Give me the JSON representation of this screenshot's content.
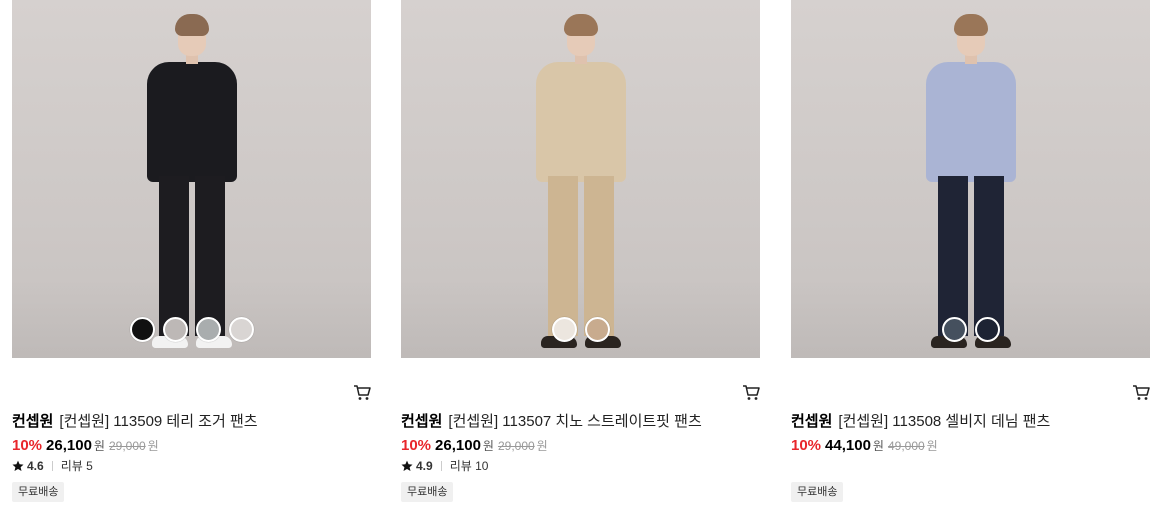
{
  "products": [
    {
      "brand": "컨셉원",
      "name": "[컨셉원] 113509 테리 조거 팬츠",
      "discount": "10%",
      "sale_price": "26,100",
      "currency": "원",
      "original_price": "29,000",
      "rating": "4.6",
      "reviews": "리뷰 5",
      "badge": "무료배송",
      "swatches": [
        "#111111",
        "#bdb8b6",
        "#a9adae",
        "#d9d5d3"
      ],
      "outfit": {
        "top": "#1b1b1f",
        "bottom": "#1d1c20",
        "shoes": "#f2f2f2",
        "hair": "#8a6a52"
      }
    },
    {
      "brand": "컨셉원",
      "name": "[컨셉원] 113507 치노 스트레이트핏 팬츠",
      "discount": "10%",
      "sale_price": "26,100",
      "currency": "원",
      "original_price": "29,000",
      "rating": "4.9",
      "reviews": "리뷰 10",
      "badge": "무료배송",
      "swatches": [
        "#ece6df",
        "#c8ab8e"
      ],
      "outfit": {
        "top": "#d9c6a8",
        "bottom": "#cdb592",
        "shoes": "#2a2420",
        "hair": "#9a7658"
      }
    },
    {
      "brand": "컨셉원",
      "name": "[컨셉원] 113508 셀비지 데님 팬츠",
      "discount": "10%",
      "sale_price": "44,100",
      "currency": "원",
      "original_price": "49,000",
      "rating": "",
      "reviews": "",
      "badge": "무료배송",
      "swatches": [
        "#45505e",
        "#1d2333"
      ],
      "outfit": {
        "top": "#aab4d4",
        "bottom": "#1f2435",
        "shoes": "#2a2420",
        "hair": "#9a7658"
      }
    }
  ],
  "icons": {
    "cart": "cart-icon",
    "star": "star-icon"
  }
}
